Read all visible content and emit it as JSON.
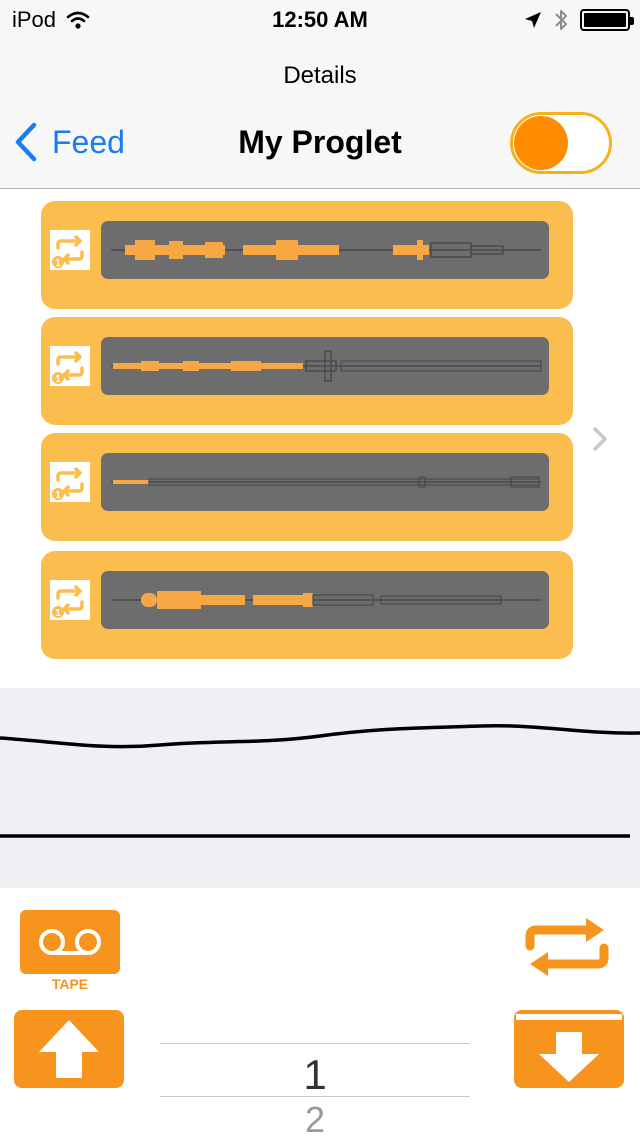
{
  "status_bar": {
    "carrier": "iPod",
    "time": "12:50 AM",
    "icons": [
      "wifi-icon",
      "location-arrow-icon",
      "bluetooth-icon",
      "battery-icon"
    ]
  },
  "nav": {
    "prompt": "Details",
    "back_label": "Feed",
    "title": "My Proglet",
    "toggle_on": true
  },
  "clips": [
    {
      "icon": "repeat-once-icon",
      "waveform": "clip-1-waveform"
    },
    {
      "icon": "repeat-once-icon",
      "waveform": "clip-2-waveform"
    },
    {
      "icon": "repeat-once-icon",
      "waveform": "clip-3-waveform"
    },
    {
      "icon": "repeat-once-icon",
      "waveform": "clip-4-waveform"
    }
  ],
  "controls": {
    "tape_label": "TAPE",
    "picker": {
      "selected": "1",
      "next": "2"
    }
  },
  "colors": {
    "accent": "#f7941d",
    "toggle_knob": "#ff8c00",
    "clip_background": "#fbbd4e",
    "waveform_background": "#6d6d6d",
    "link": "#1a7cf2"
  }
}
